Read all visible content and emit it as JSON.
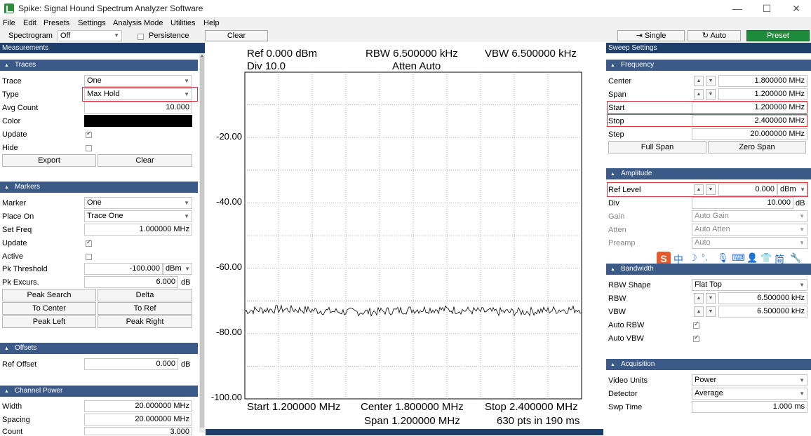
{
  "window": {
    "title": "Spike: Signal Hound Spectrum Analyzer Software",
    "minimize": "—",
    "maximize": "☐",
    "close": "✕"
  },
  "menu": [
    "File",
    "Edit",
    "Presets",
    "Settings",
    "Analysis Mode",
    "Utilities",
    "Help"
  ],
  "toolbar": {
    "spectrogram_label": "Spectrogram",
    "spectrogram_value": "Off",
    "persistence_label": "Persistence",
    "clear_label": "Clear",
    "single_label": "Single",
    "auto_label": "Auto",
    "preset_label": "Preset"
  },
  "left_panel": {
    "title": "Measurements",
    "traces": {
      "header": "Traces",
      "trace_label": "Trace",
      "trace_value": "One",
      "type_label": "Type",
      "type_value": "Max Hold",
      "avg_count_label": "Avg Count",
      "avg_count_value": "10.000",
      "color_label": "Color",
      "update_label": "Update",
      "hide_label": "Hide",
      "export_label": "Export",
      "clear_label": "Clear"
    },
    "markers": {
      "header": "Markers",
      "marker_label": "Marker",
      "marker_value": "One",
      "place_on_label": "Place On",
      "place_on_value": "Trace One",
      "set_freq_label": "Set Freq",
      "set_freq_value": "1.000000 MHz",
      "update_label": "Update",
      "active_label": "Active",
      "pk_threshold_label": "Pk Threshold",
      "pk_threshold_value": "-100.000",
      "pk_threshold_unit": "dBm",
      "pk_excurs_label": "Pk Excurs.",
      "pk_excurs_value": "6.000",
      "pk_excurs_unit": "dB",
      "peak_search": "Peak Search",
      "delta": "Delta",
      "to_center": "To Center",
      "to_ref": "To Ref",
      "peak_left": "Peak Left",
      "peak_right": "Peak Right"
    },
    "offsets": {
      "header": "Offsets",
      "ref_offset_label": "Ref Offset",
      "ref_offset_value": "0.000",
      "ref_offset_unit": "dB"
    },
    "channel_power": {
      "header": "Channel Power",
      "width_label": "Width",
      "width_value": "20.000000 MHz",
      "spacing_label": "Spacing",
      "spacing_value": "20.000000 MHz",
      "count_label": "Count",
      "count_value": "3.000"
    }
  },
  "plot": {
    "ref": "Ref 0.000 dBm",
    "div": "Div 10.0",
    "rbw": "RBW 6.500000 kHz",
    "vbw": "VBW 6.500000 kHz",
    "atten": "Atten Auto",
    "start": "Start 1.200000 MHz",
    "center": "Center 1.800000 MHz",
    "stop": "Stop 2.400000 MHz",
    "span": "Span 1.200000 MHz",
    "pts": "630 pts in 190 ms",
    "y_labels": [
      "-20.00",
      "-40.00",
      "-60.00",
      "-80.00",
      "-100.00"
    ],
    "trace_level_dbm": -73,
    "y_range_dbm": [
      -100,
      0
    ],
    "trace_color": "#000000"
  },
  "right_panel": {
    "title": "Sweep Settings",
    "frequency": {
      "header": "Frequency",
      "center_label": "Center",
      "center_value": "1.800000 MHz",
      "span_label": "Span",
      "span_value": "1.200000 MHz",
      "start_label": "Start",
      "start_value": "1.200000 MHz",
      "stop_label": "Stop",
      "stop_value": "2.400000 MHz",
      "step_label": "Step",
      "step_value": "20.000000 MHz",
      "full_span": "Full Span",
      "zero_span": "Zero Span"
    },
    "amplitude": {
      "header": "Amplitude",
      "ref_level_label": "Ref Level",
      "ref_level_value": "0.000",
      "ref_level_unit": "dBm",
      "div_label": "Div",
      "div_value": "10.000",
      "div_unit": "dB",
      "gain_label": "Gain",
      "gain_value": "Auto Gain",
      "atten_label": "Atten",
      "atten_value": "Auto Atten",
      "preamp_label": "Preamp",
      "preamp_value": "Auto"
    },
    "ime_toolbar": [
      "中",
      "简"
    ],
    "bandwidth": {
      "header": "Bandwidth",
      "rbw_shape_label": "RBW Shape",
      "rbw_shape_value": "Flat Top",
      "rbw_label": "RBW",
      "rbw_value": "6.500000 kHz",
      "vbw_label": "VBW",
      "vbw_value": "6.500000 kHz",
      "auto_rbw_label": "Auto RBW",
      "auto_vbw_label": "Auto VBW"
    },
    "acquisition": {
      "header": "Acquisition",
      "video_units_label": "Video Units",
      "video_units_value": "Power",
      "detector_label": "Detector",
      "detector_value": "Average",
      "swp_time_label": "Swp Time",
      "swp_time_value": "1.000 ms"
    }
  },
  "colors": {
    "panel_header": "#1f3f6b",
    "group_header": "#3c5a87",
    "preset_button": "#1e8a3c",
    "highlight": "#d9353d"
  }
}
